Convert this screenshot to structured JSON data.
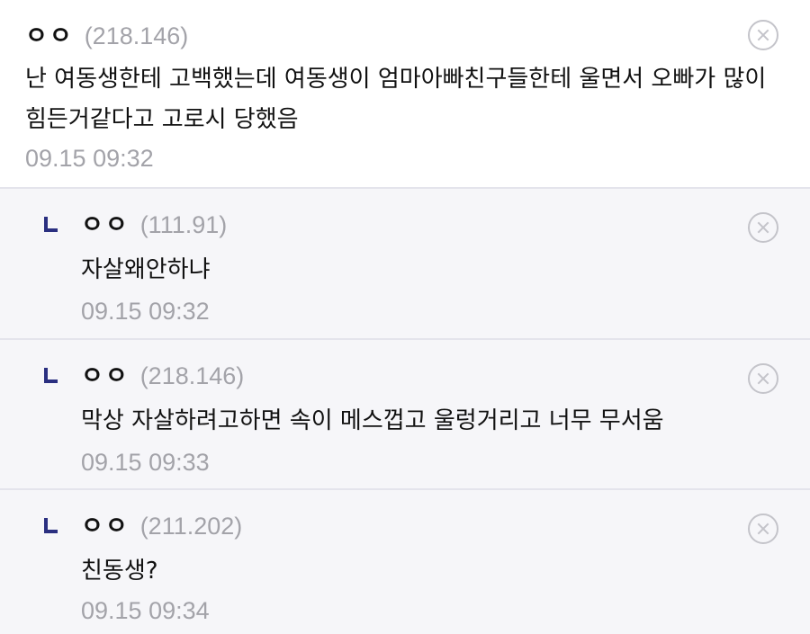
{
  "comments": [
    {
      "nickname": "ㅇㅇ",
      "ip": "(218.146)",
      "text": "난 여동생한테 고백했는데 여동생이 엄마아빠친구들한테 울면서 오빠가 많이 힘든거같다고 고로시 당했음",
      "datetime": "09.15 09:32"
    }
  ],
  "replies": [
    {
      "nickname": "ㅇㅇ",
      "ip": "(111.91)",
      "text": "자살왜안하냐",
      "datetime": "09.15 09:32"
    },
    {
      "nickname": "ㅇㅇ",
      "ip": "(218.146)",
      "text": "막상 자살하려고하면 속이 메스껍고 울렁거리고 너무 무서움",
      "datetime": "09.15 09:33"
    },
    {
      "nickname": "ㅇㅇ",
      "ip": "(211.202)",
      "text": "친동생?",
      "datetime": "09.15 09:34"
    }
  ],
  "icons": {
    "delete": "close-circle-icon",
    "reply_marker": "reply-corner-icon"
  },
  "colors": {
    "reply_marker": "#2a2f80",
    "meta_gray": "#a3a3a9",
    "reply_background": "#f6f6f9"
  }
}
